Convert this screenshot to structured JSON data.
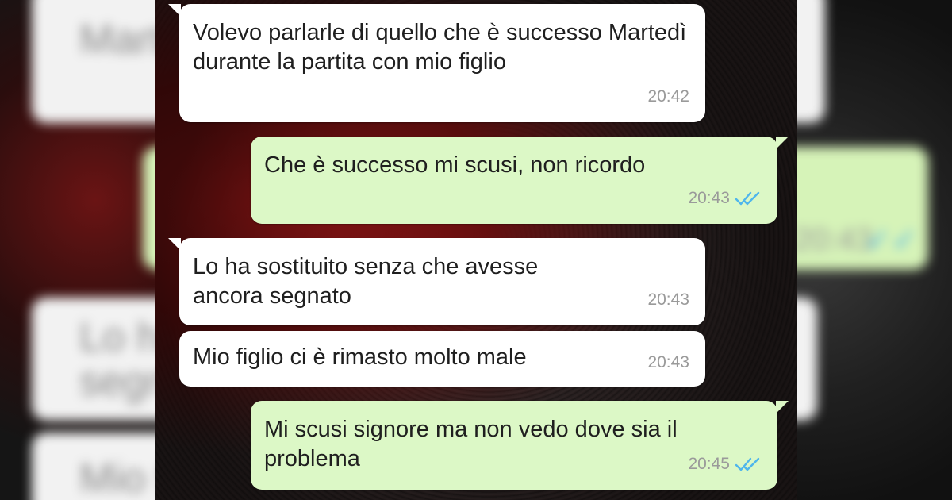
{
  "colors": {
    "incoming_bubble": "#ffffff",
    "outgoing_bubble": "#dcf8c6",
    "read_ticks": "#4fb6ec",
    "timestamp": "#9a9a9a"
  },
  "messages": [
    {
      "direction": "incoming",
      "text": "Volevo parlarle di quello che è successo Martedì durante la partita con mio figlio",
      "time": "20:42"
    },
    {
      "direction": "outgoing",
      "text": "Che è successo mi scusi, non ricordo",
      "time": "20:43",
      "status": "read-double-tick-icon"
    },
    {
      "direction": "incoming",
      "text": "Lo ha sostituito senza che avesse ancora segnato",
      "time": "20:43"
    },
    {
      "direction": "incoming",
      "text": "Mio figlio ci è rimasto molto male",
      "time": "20:43"
    },
    {
      "direction": "outgoing",
      "text": "Mi scusi signore ma non vedo dove sia il problema",
      "time": "20:45",
      "status": "read-double-tick-icon"
    }
  ],
  "background_blur": {
    "left_fragments": [
      "Marte",
      "Lo ha",
      "segna",
      "Mio fi"
    ],
    "right_time": "20:43"
  }
}
